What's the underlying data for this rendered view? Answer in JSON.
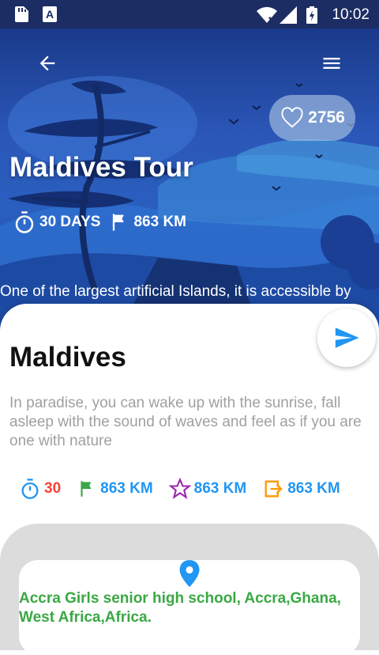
{
  "status_bar": {
    "time": "10:02"
  },
  "hero": {
    "likes": "2756",
    "title": "Maldives Tour",
    "days": "30 DAYS",
    "distance": "863 KM",
    "description": "One of the largest artificial Islands, it is accessible by"
  },
  "card": {
    "title": "Maldives",
    "description": "In paradise, you can wake up with the sunrise, fall asleep with the sound of waves and feel as if you are one with nature",
    "stats": {
      "timer_value": "30",
      "flag_value": "863 KM",
      "star_value": "863 KM",
      "exit_value": "863 KM"
    },
    "address": "Accra Girls senior high school, Accra,Ghana, West Africa,Africa."
  },
  "colors": {
    "status_bar": "#1c2d63",
    "accent_blue": "#2196f3",
    "red": "#f44336",
    "green": "#3aa844",
    "purple": "#9c27b0",
    "orange": "#ff9800"
  },
  "icons": [
    "sd-card-icon",
    "font-icon",
    "wifi-icon",
    "signal-icon",
    "battery-icon",
    "back-arrow-icon",
    "menu-icon",
    "heart-icon",
    "timer-icon",
    "flag-icon",
    "send-icon",
    "star-icon",
    "exit-icon",
    "location-pin-icon"
  ]
}
